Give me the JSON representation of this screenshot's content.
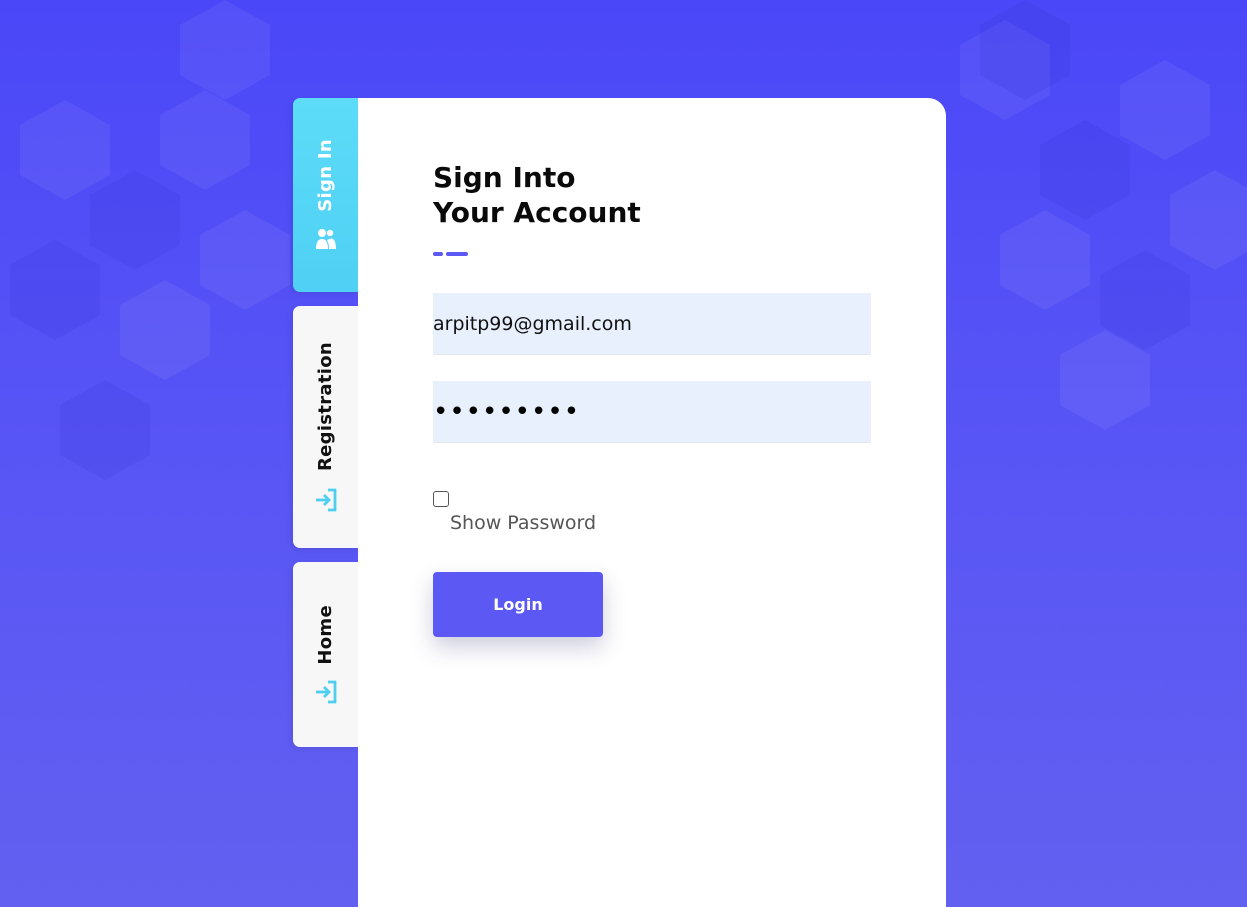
{
  "tabs": [
    {
      "label": "Sign In",
      "icon": "users-icon",
      "active": true
    },
    {
      "label": "Registration",
      "icon": "sign-in-arrow-icon",
      "active": false
    },
    {
      "label": "Home",
      "icon": "sign-in-arrow-icon",
      "active": false
    }
  ],
  "form": {
    "title_line1": "Sign Into",
    "title_line2": "Your Account",
    "email_value": "arpitp99@gmail.com",
    "password_masked": "•••••••••",
    "show_password_label": "Show Password",
    "show_password_checked": false,
    "login_label": "Login"
  },
  "colors": {
    "accent": "#5b58f3",
    "active_tab": "#55d6f6",
    "field_bg": "#e8f0fd"
  }
}
